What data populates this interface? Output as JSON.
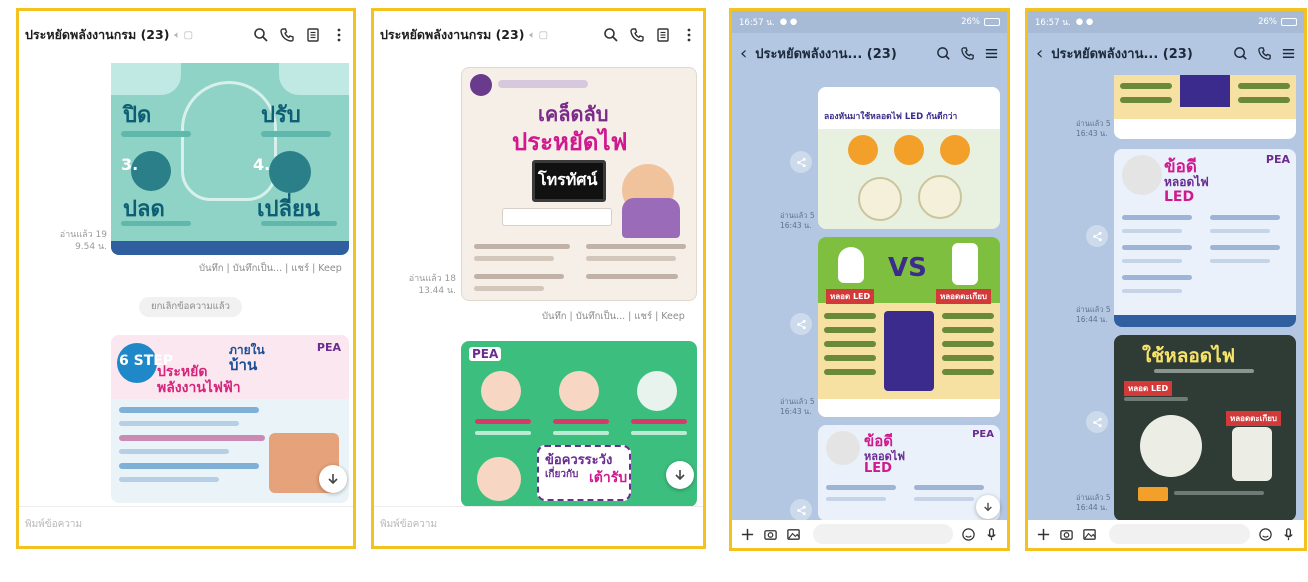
{
  "panel1": {
    "title": "ประหยัดพลังงานกรม (23)",
    "read_receipt_1": "อ่านแล้ว 19",
    "read_time_1": "9.54 น.",
    "actions": "บันทึก | บันทึกเป็น... | แชร์ | Keep",
    "system_message": "ยกเลิกข้อความแล้ว",
    "input_placeholder": "พิมพ์ข้อความ",
    "poster1": {
      "word1": "ปิด",
      "word2": "ปรับ",
      "word3": "ปลด",
      "word4": "เปลี่ยน",
      "num3": "3.",
      "num4": "4."
    },
    "poster2": {
      "step": "6 STEP",
      "inhome_a": "ภายใน",
      "inhome_b": "บ้าน",
      "title_a": "ประหยัด",
      "title_b": "พลังงานไฟฟ้า",
      "brand": "PEA"
    }
  },
  "panel2": {
    "title": "ประหยัดพลังงานกรม (23)",
    "read_receipt": "อ่านแล้ว 18",
    "read_time": "13.44 น.",
    "actions": "บันทึก | บันทึกเป็น... | แชร์ | Keep",
    "input_placeholder": "พิมพ์ข้อความ",
    "poster1": {
      "line1": "เคล็ดลับ",
      "line2": "ประหยัดไฟ",
      "line3": "โทรทัศน์"
    },
    "poster2": {
      "brand": "PEA",
      "caution_a": "ข้อควรระวัง",
      "caution_b": "เกี่ยวกับ",
      "caution_c": "เต้ารับ"
    }
  },
  "panel3": {
    "status_time": "16:57 น.",
    "battery": "26%",
    "title": "ประหยัดพลังงาน... (23)",
    "read_a": "อ่านแล้ว 5",
    "time_a": "16:43 น.",
    "read_b": "อ่านแล้ว 5",
    "time_b": "16:43 น.",
    "poster1": {
      "headline": "ลองหันมาใช้หลอดไฟ LED กันดีกว่า"
    },
    "poster2": {
      "left": "หลอด LED",
      "vs": "VS",
      "right": "หลอดตะเกียบ"
    },
    "poster3": {
      "line1": "ข้อดี",
      "line2": "หลอดไฟ",
      "line3": "LED",
      "brand": "PEA"
    }
  },
  "panel4": {
    "status_time": "16:57 น.",
    "battery": "26%",
    "title": "ประหยัดพลังงาน... (23)",
    "read_a": "อ่านแล้ว 5",
    "time_a": "16:43 น.",
    "read_b": "อ่านแล้ว 5",
    "time_b": "16:44 น.",
    "read_c": "อ่านแล้ว 5",
    "time_c": "16:44 น.",
    "poster1": {
      "line1": "ข้อดี",
      "line2": "หลอดไฟ",
      "line3": "LED",
      "brand": "PEA"
    },
    "poster2": {
      "headline": "ใช้หลอดไฟ",
      "led": "หลอด LED",
      "cfl": "หลอดตะเกียบ"
    }
  }
}
